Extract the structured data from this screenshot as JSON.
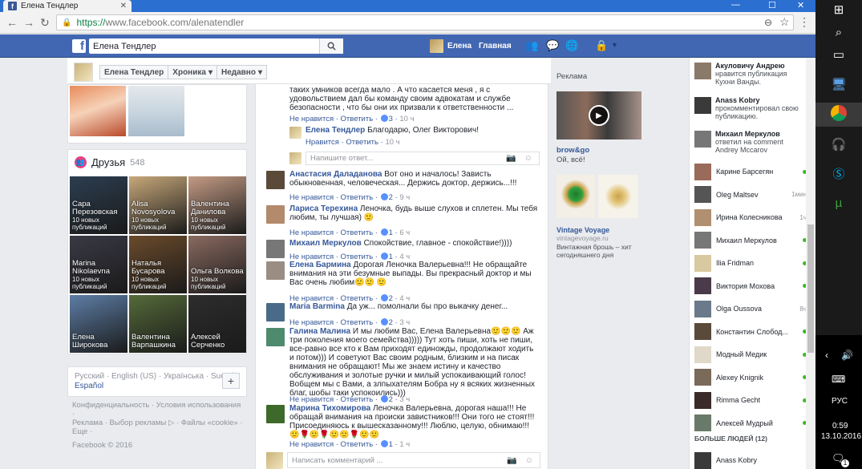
{
  "browser": {
    "tab_title": "Елена Тендлер",
    "url_scheme": "https://",
    "url_rest": "www.facebook.com/alenatendler",
    "back_icon": "←",
    "forward_icon": "→",
    "reload_icon": "↻"
  },
  "fb_bar": {
    "search_value": "Елена Тендлер",
    "user_name": "Елена",
    "home_label": "Главная"
  },
  "timeline": {
    "name_button": "Елена Тендлер",
    "chronicle_button": "Хроника",
    "recent_button": "Недавно"
  },
  "friends": {
    "title": "Друзья",
    "count": "548",
    "items": [
      {
        "name": "Сара Перезовская",
        "sub": "10 новых публикаций",
        "color": "#2c3e50"
      },
      {
        "name": "Alisa Novosyolova",
        "sub": "10 новых публикаций",
        "color": "#c7a87a"
      },
      {
        "name": "Валентина Данилова",
        "sub": "10 новых публикаций",
        "color": "#c49b84"
      },
      {
        "name": "Marina Nikolaevna",
        "sub": "10 новых публикаций",
        "color": "#3a3a46"
      },
      {
        "name": "Наталья Бусарова",
        "sub": "10 новых публикаций",
        "color": "#6b4b2b"
      },
      {
        "name": "Ольга Волкова",
        "sub": "10 новых публикаций",
        "color": "#8a6a60"
      },
      {
        "name": "Елена Широкова",
        "sub": "",
        "color": "#5d7ea6"
      },
      {
        "name": "Валентина Варпашкина",
        "sub": "",
        "color": "#556b3a"
      },
      {
        "name": "Алексей Серченко",
        "sub": "",
        "color": "#2d2d2d"
      }
    ]
  },
  "languages": {
    "line1": "Русский · English (US) · Українська · Suomi ·",
    "line2": "Español",
    "plus_label": "+"
  },
  "footer": {
    "line1": "Конфиденциальность · Условия использования ·",
    "line2": "Реклама · Выбор рекламы ▷ · Файлы «cookie» ·",
    "line3": "Еще ·",
    "copyright": "Facebook © 2016"
  },
  "comments": {
    "top_text": "таких умников всегда мало . А что касается меня , я с удовольствием дал бы команду своим адвокатам и службе безопасности , что бы они их призвали к ответственности ...",
    "top_actions": {
      "unlike": "Не нравится",
      "reply": "Ответить",
      "likes": "3",
      "time": "10 ч"
    },
    "reply1": {
      "name": "Елена Тендлер",
      "text": "Благодарю, Олег Викторович!",
      "like": "Нравится",
      "reply": "Ответить",
      "time": "10 ч"
    },
    "reply_placeholder": "Напишите ответ...",
    "items": [
      {
        "name": "Анастасия Даладанова",
        "text": "Вот оно и началось! Зависть обыкновенная, человеческая... Держись доктор, держись...!!!",
        "likes": "2",
        "time": "9 ч",
        "color": "#5b4a3a"
      },
      {
        "name": "Лариса Терехина",
        "text": "Леночка, будь выше слухов и сплетен. Мы тебя любим, ты лучшая) 🙂",
        "likes": "1",
        "time": "6 ч",
        "color": "#b38a6b"
      },
      {
        "name": "Михаил Меркулов",
        "text": "Спокойствие, главное - спокойствие!))))",
        "likes": "1",
        "time": "4 ч",
        "color": "#777777"
      },
      {
        "name": "Елена Бармина",
        "text": "Дорогая Леночка Валерьевна!!! Не обращайте внимания на эти безумные выпады. Вы прекрасный доктор и мы Вас очень любим🙂🙂 🙂",
        "likes": "2",
        "time": "4 ч",
        "color": "#9a8e84"
      },
      {
        "name": "Maria Barmina",
        "text": "Да уж... помолнали бы про выкачку денег...",
        "likes": "2",
        "time": "3 ч",
        "color": "#4a6a8a"
      },
      {
        "name": "Галина Малина",
        "text": "И мы любим Вас, Елена Валерьевна🙂🙂🙂 Аж три поколения моего семейства))))) Тут хоть пиши, хоть не пиши, все-равно все кто к Вам приходят единожды, продолжают ходить и потом))) И советуют Вас своим родным, близким и на писак внимания не обращают! Мы же знаем истину и качество обслуживания и золотые ручки и милый успокаивающий голос! Вобщем мы с Вами, а злпыхателям Бобра ну я всяких жизненных благ, шобы таки успокоились)))",
        "likes": "2",
        "time": "3 ч",
        "color": "#4e8a6e"
      },
      {
        "name": "Марина Тихомирова",
        "text": "Леночка Валерьевна, дорогая наша!!! Не обращай внимания на происки завистников!!! Они того не стоят!!! Присоединяюсь к вышесказанному!!! Люблю, целую, обнимаю!!! 🙂🌹🙂🌹🙂🙂🌹🙂🙂",
        "likes": "1",
        "time": "1 ч",
        "color": "#3d6a2a"
      }
    ],
    "unlike_label": "Не нравится",
    "reply_label": "Ответить",
    "comment_placeholder": "Написать комментарий ..."
  },
  "ads": {
    "label": "Реклама",
    "ad1_title": "brow&go",
    "ad1_text": "Ой, всё!",
    "ad2_title": "Vintage Voyage",
    "ad2_domain": "vintagevoyage.ru",
    "ad2_text": "Винтажная брошь – хит сегодняшнего дня"
  },
  "notifications": [
    {
      "name": "Акуловичу Андрею",
      "text": "нравится публикация Кухни Ванды.",
      "color": "#8a7a6a"
    },
    {
      "name": "Anass Kobry",
      "text": "прокомментировал свою публикацию.",
      "color": "#3a3a3a"
    },
    {
      "name": "Михаил Меркулов",
      "text": "ответил на comment Andrey Mccarov",
      "color": "#777777"
    }
  ],
  "contacts": [
    {
      "name": "Карине Барсегян",
      "time": "",
      "online": true,
      "color": "#9a6a5a"
    },
    {
      "name": "Oleg Maltsev",
      "time": "1мин",
      "online": false,
      "color": "#555555"
    },
    {
      "name": "Ирина Колесникова",
      "time": "1ч",
      "online": false,
      "color": "#b09070"
    },
    {
      "name": "Михаил Меркулов",
      "time": "",
      "online": true,
      "color": "#777777"
    },
    {
      "name": "Ilia Fridman",
      "time": "",
      "online": true,
      "color": "#d9c9a0"
    },
    {
      "name": "Виктория Мохова",
      "time": "",
      "online": true,
      "color": "#4a3a4a"
    },
    {
      "name": "Olga Oussova",
      "time": "8ч",
      "online": false,
      "color": "#6a7a8a"
    },
    {
      "name": "Константин Слобод...",
      "time": "",
      "online": true,
      "color": "#5a4a3a"
    },
    {
      "name": "Модный Медик",
      "time": "",
      "online": true,
      "color": "#e0d8c8"
    },
    {
      "name": "Alexey Knignik",
      "time": "",
      "online": true,
      "color": "#7a6a5a"
    },
    {
      "name": "Rimma Gecht",
      "time": "",
      "online": true,
      "color": "#3a2a2a"
    },
    {
      "name": "Алексей Мудрый",
      "time": "",
      "online": true,
      "color": "#6a7a6a"
    }
  ],
  "more_people": "БОЛЬШЕ ЛЮДЕЙ (12)",
  "last_contact": "Anass Kobry",
  "taskbar": {
    "lang": "РУС",
    "time": "0:59",
    "date": "13.10.2016",
    "notif_count": "1"
  }
}
